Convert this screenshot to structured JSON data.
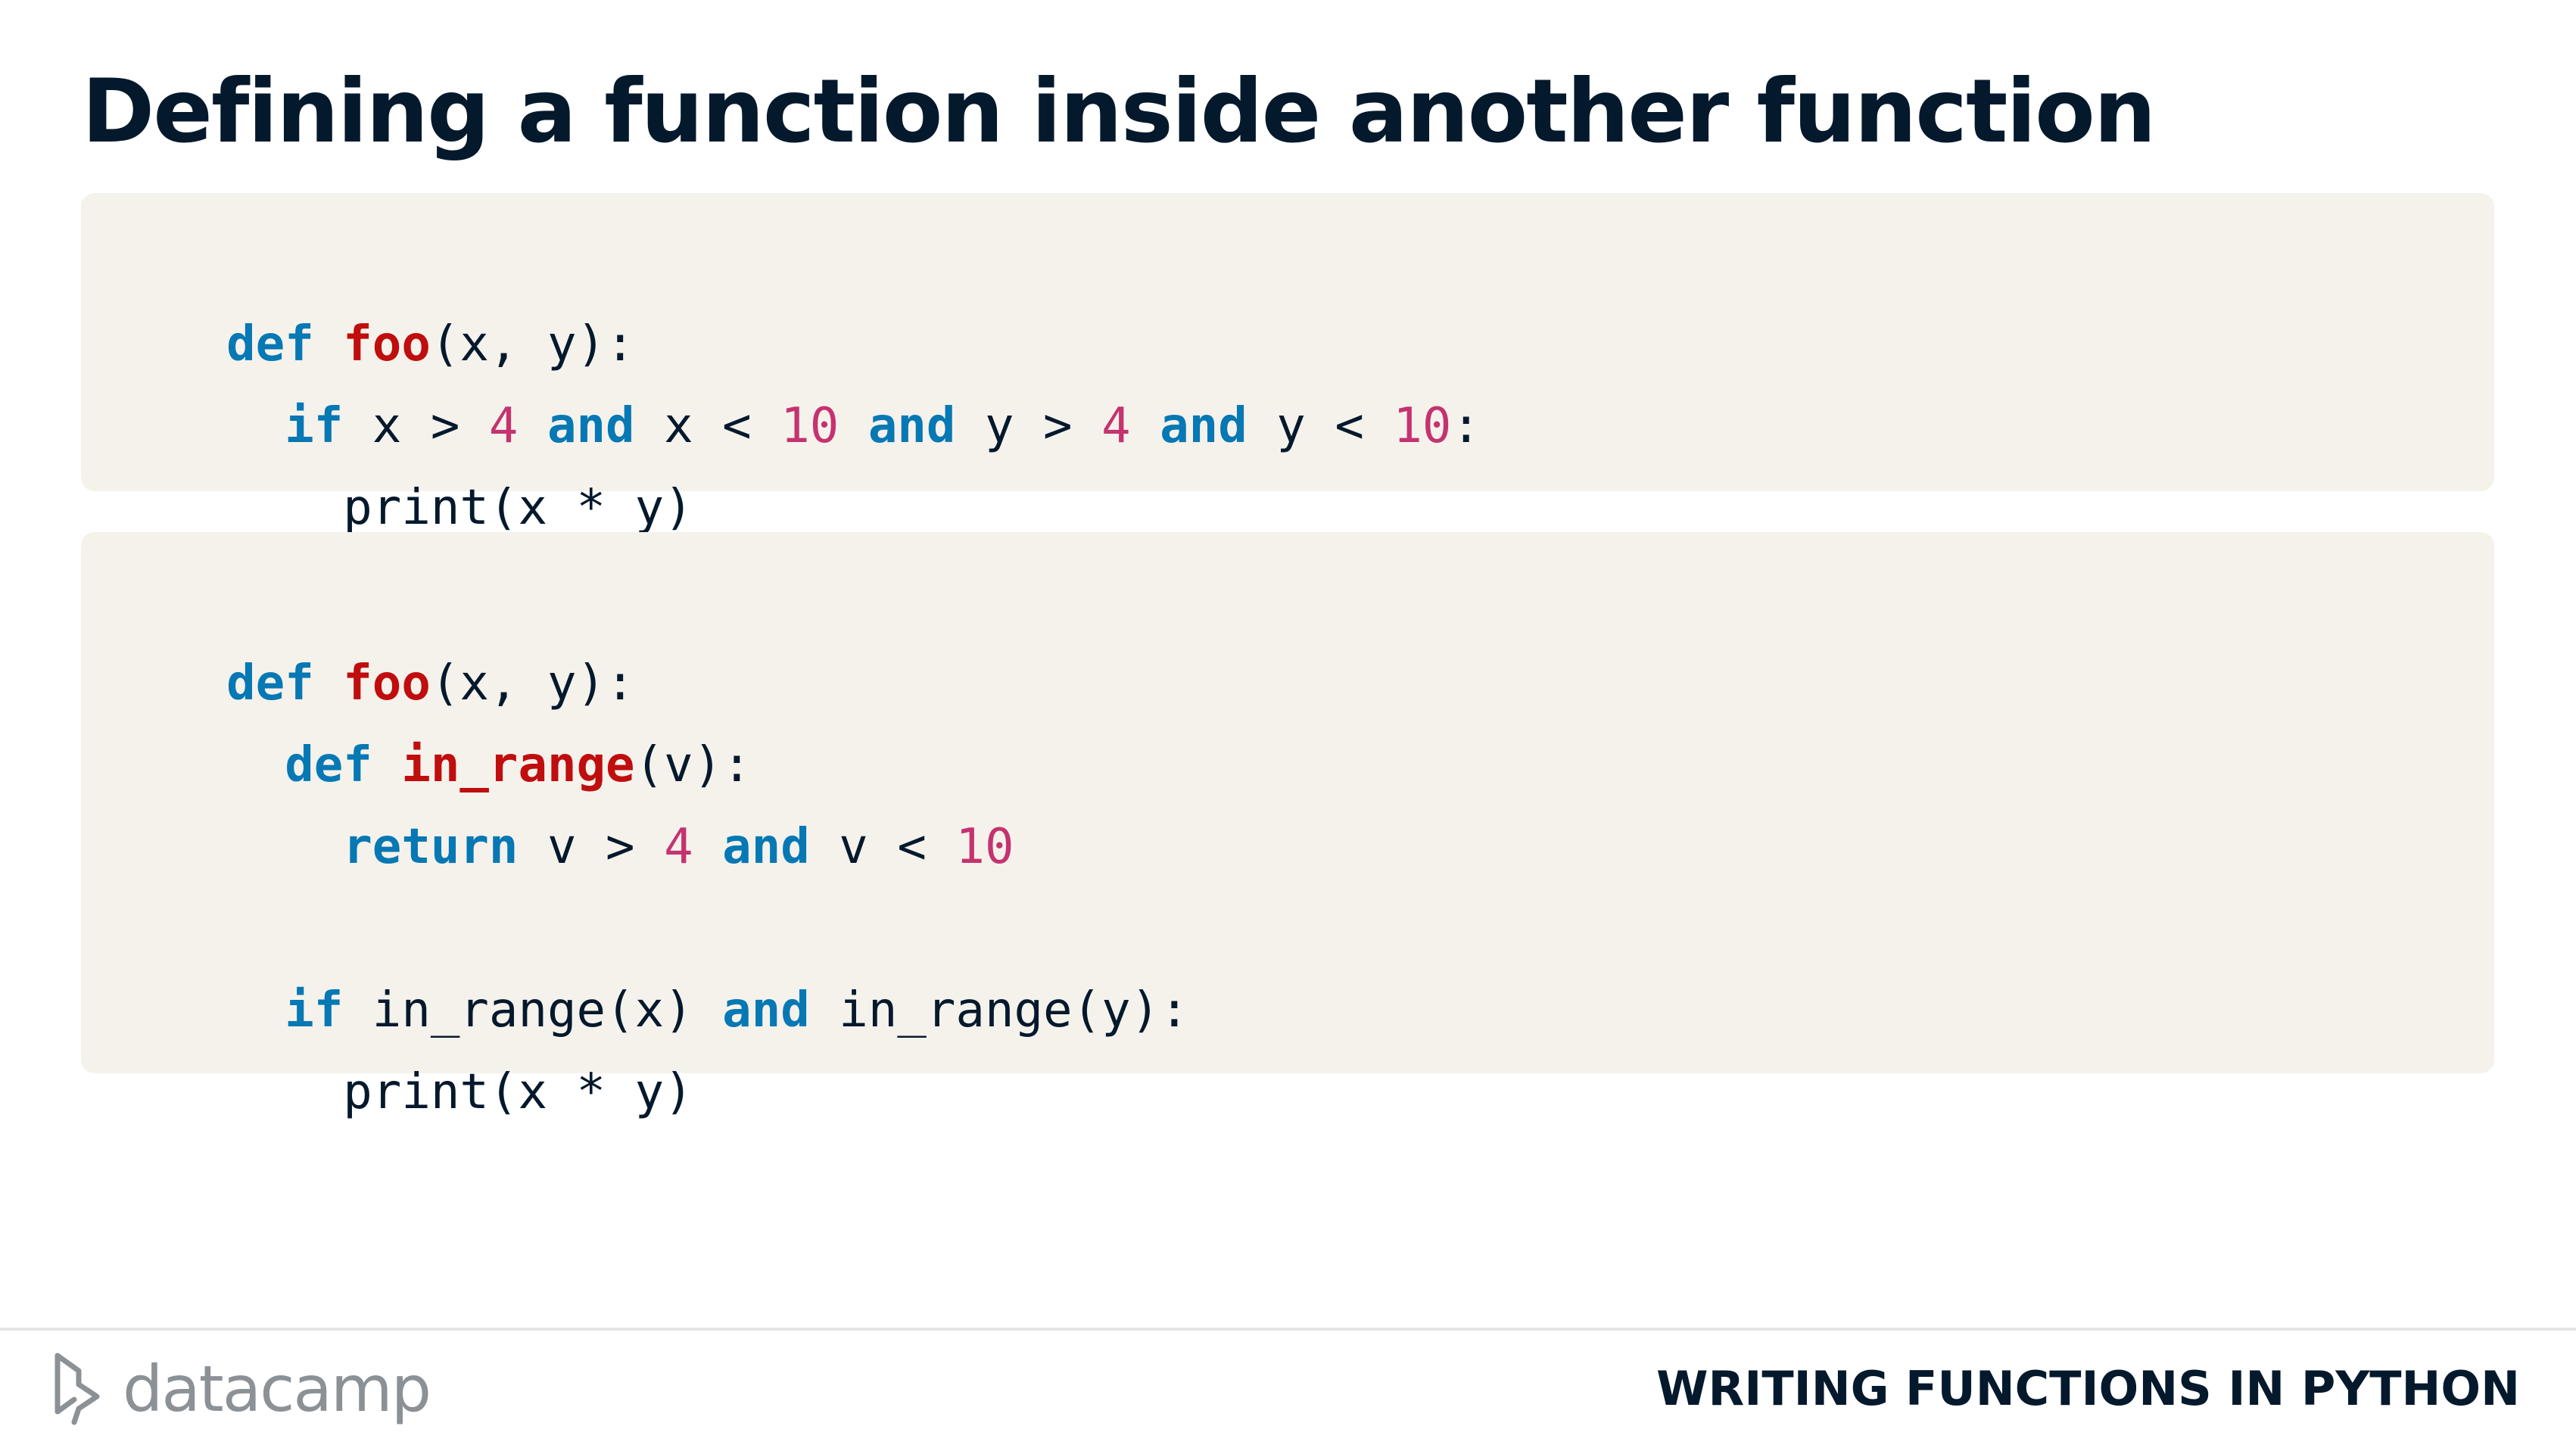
{
  "slide": {
    "title": "Defining a function inside another function"
  },
  "code_blocks": [
    {
      "lines": [
        [
          {
            "t": "kw",
            "v": "def"
          },
          {
            "t": "p",
            "v": " "
          },
          {
            "t": "fn",
            "v": "foo"
          },
          {
            "t": "p",
            "v": "(x, y):"
          }
        ],
        [
          {
            "t": "p",
            "v": "  "
          },
          {
            "t": "kw",
            "v": "if"
          },
          {
            "t": "p",
            "v": " x > "
          },
          {
            "t": "num",
            "v": "4"
          },
          {
            "t": "p",
            "v": " "
          },
          {
            "t": "kw",
            "v": "and"
          },
          {
            "t": "p",
            "v": " x < "
          },
          {
            "t": "num",
            "v": "10"
          },
          {
            "t": "p",
            "v": " "
          },
          {
            "t": "kw",
            "v": "and"
          },
          {
            "t": "p",
            "v": " y > "
          },
          {
            "t": "num",
            "v": "4"
          },
          {
            "t": "p",
            "v": " "
          },
          {
            "t": "kw",
            "v": "and"
          },
          {
            "t": "p",
            "v": " y < "
          },
          {
            "t": "num",
            "v": "10"
          },
          {
            "t": "p",
            "v": ":"
          }
        ],
        [
          {
            "t": "p",
            "v": "    print(x * y)"
          }
        ]
      ]
    },
    {
      "lines": [
        [
          {
            "t": "kw",
            "v": "def"
          },
          {
            "t": "p",
            "v": " "
          },
          {
            "t": "fn",
            "v": "foo"
          },
          {
            "t": "p",
            "v": "(x, y):"
          }
        ],
        [
          {
            "t": "p",
            "v": "  "
          },
          {
            "t": "kw",
            "v": "def"
          },
          {
            "t": "p",
            "v": " "
          },
          {
            "t": "fn",
            "v": "in_range"
          },
          {
            "t": "p",
            "v": "(v):"
          }
        ],
        [
          {
            "t": "p",
            "v": "    "
          },
          {
            "t": "kw",
            "v": "return"
          },
          {
            "t": "p",
            "v": " v > "
          },
          {
            "t": "num",
            "v": "4"
          },
          {
            "t": "p",
            "v": " "
          },
          {
            "t": "kw",
            "v": "and"
          },
          {
            "t": "p",
            "v": " v < "
          },
          {
            "t": "num",
            "v": "10"
          }
        ],
        [],
        [
          {
            "t": "p",
            "v": "  "
          },
          {
            "t": "kw",
            "v": "if"
          },
          {
            "t": "p",
            "v": " in_range(x) "
          },
          {
            "t": "kw",
            "v": "and"
          },
          {
            "t": "p",
            "v": " in_range(y):"
          }
        ],
        [
          {
            "t": "p",
            "v": "    print(x * y)"
          }
        ]
      ]
    }
  ],
  "footer": {
    "logo_text": "datacamp",
    "course_title": "WRITING FUNCTIONS IN PYTHON"
  },
  "colors": {
    "title": "#05192d",
    "keyword": "#0678b4",
    "function_name": "#c00d0d",
    "number": "#c4336f",
    "code_background": "#f5f2ec",
    "logo": "#8c9196"
  },
  "icons": {
    "logo": "datacamp-logo-icon"
  }
}
